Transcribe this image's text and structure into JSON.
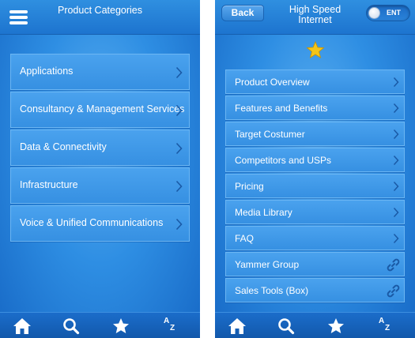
{
  "left": {
    "header": {
      "title": "Product Categories"
    },
    "categories": [
      {
        "label": "Applications"
      },
      {
        "label": "Consultancy & Management Services"
      },
      {
        "label": "Data & Connectivity"
      },
      {
        "label": "Infrastructure"
      },
      {
        "label": "Voice & Unified Communications"
      }
    ]
  },
  "right": {
    "header": {
      "title_line1": "High Speed",
      "title_line2": "Internet",
      "back_label": "Back",
      "toggle_label": "ENT"
    },
    "items": [
      {
        "label": "Product Overview",
        "icon": "chevron-right-icon"
      },
      {
        "label": "Features and Benefits",
        "icon": "chevron-right-icon"
      },
      {
        "label": "Target Costumer",
        "icon": "chevron-right-icon"
      },
      {
        "label": "Competitors and USPs",
        "icon": "chevron-right-icon"
      },
      {
        "label": "Pricing",
        "icon": "chevron-right-icon"
      },
      {
        "label": "Media Library",
        "icon": "chevron-right-icon"
      },
      {
        "label": "FAQ",
        "icon": "chevron-right-icon"
      },
      {
        "label": "Yammer Group",
        "icon": "link-icon"
      },
      {
        "label": "Sales Tools (Box)",
        "icon": "link-icon"
      }
    ]
  },
  "tabbar": {
    "icons": [
      "home-icon",
      "search-icon",
      "star-icon",
      "az-sort-icon"
    ],
    "az_top": "A",
    "az_bottom": "Z"
  },
  "colors": {
    "accent": "#2e8ee3",
    "star": "#f5c518",
    "text": "#ffffff"
  }
}
